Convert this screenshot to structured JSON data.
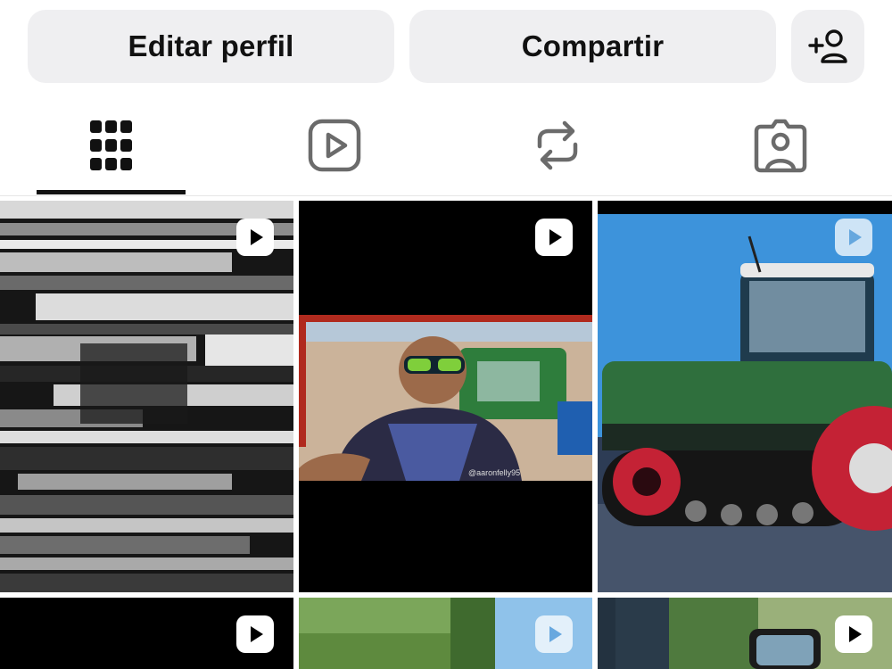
{
  "actions": {
    "edit_profile_label": "Editar perfil",
    "share_label": "Compartir"
  },
  "tabs": [
    {
      "name": "grid",
      "icon": "grid-icon",
      "selected": true
    },
    {
      "name": "reels",
      "icon": "reels-icon",
      "selected": false
    },
    {
      "name": "reposts",
      "icon": "repost-icon",
      "selected": false
    },
    {
      "name": "tagged",
      "icon": "tagged-icon",
      "selected": false
    }
  ],
  "posts": [
    {
      "type": "reel",
      "thumbnail": "glitch-static"
    },
    {
      "type": "reel",
      "thumbnail": "selfie-in-field",
      "watermark": "@aaronfelly95"
    },
    {
      "type": "reel",
      "thumbnail": "green-tracked-tractor"
    },
    {
      "type": "reel",
      "thumbnail": "dark"
    },
    {
      "type": "reel",
      "thumbnail": "grass-field"
    },
    {
      "type": "reel",
      "thumbnail": "tractor-cab-mirror"
    }
  ],
  "colors": {
    "button_bg": "#efeff1",
    "text": "#111111",
    "icon_gray": "#6b6b6b"
  }
}
